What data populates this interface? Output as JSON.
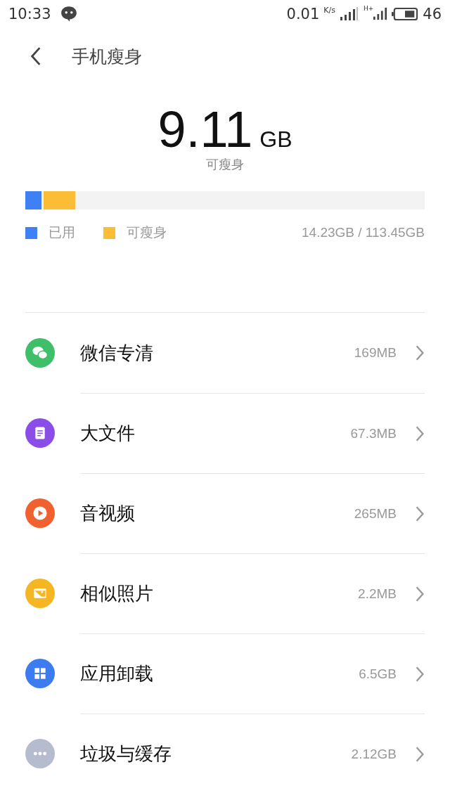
{
  "status_bar": {
    "time": "10:33",
    "speed": "0.01",
    "speed_unit": "K/s",
    "network": "H+",
    "battery": "46"
  },
  "header": {
    "title": "手机瘦身"
  },
  "summary": {
    "amount": "9.11",
    "unit": "GB",
    "caption": "可瘦身"
  },
  "storage_bar": {
    "segments": [
      {
        "level": 0.04,
        "color": "#4080f5"
      },
      {
        "level": 0.08,
        "color": "#fbbc36"
      }
    ]
  },
  "legend": {
    "entries": [
      {
        "label": "已用",
        "color": "#4080f5"
      },
      {
        "label": "可瘦身",
        "color": "#fbbc36"
      }
    ],
    "usage": "14.23GB / 113.45GB"
  },
  "items": [
    {
      "kind": "chat",
      "color": "#3fbf6a",
      "label": "微信专清",
      "size": "169MB"
    },
    {
      "kind": "document",
      "color": "#8a4de8",
      "label": "大文件",
      "size": "67.3MB"
    },
    {
      "kind": "play",
      "color": "#f0612f",
      "label": "音视频",
      "size": "265MB"
    },
    {
      "kind": "photo",
      "color": "#f5b623",
      "label": "相似照片",
      "size": "2.2MB"
    },
    {
      "kind": "apps",
      "color": "#3b7cf0",
      "label": "应用卸载",
      "size": "6.5GB"
    },
    {
      "kind": "more",
      "color": "#b4bccd",
      "label": "垃圾与缓存",
      "size": "2.12GB"
    }
  ]
}
